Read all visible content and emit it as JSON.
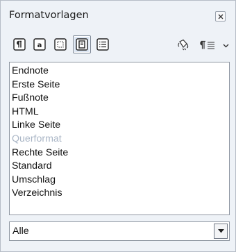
{
  "panel": {
    "title": "Formatvorlagen"
  },
  "toolbar": {
    "buttons": [
      {
        "icon": "paragraph-styles-icon"
      },
      {
        "icon": "character-styles-icon"
      },
      {
        "icon": "frame-styles-icon"
      },
      {
        "icon": "page-styles-icon",
        "active": true
      },
      {
        "icon": "list-styles-icon"
      }
    ],
    "fill_format_icon": "fill-format-mode-icon",
    "new_style_icon": "new-style-from-selection-icon"
  },
  "styles": {
    "items": [
      {
        "label": "Endnote"
      },
      {
        "label": "Erste Seite"
      },
      {
        "label": "Fußnote"
      },
      {
        "label": "HTML"
      },
      {
        "label": "Linke Seite"
      },
      {
        "label": "Querformat",
        "selected": true
      },
      {
        "label": "Rechte Seite"
      },
      {
        "label": "Standard"
      },
      {
        "label": "Umschlag"
      },
      {
        "label": "Verzeichnis"
      }
    ]
  },
  "filter": {
    "value": "Alle"
  }
}
